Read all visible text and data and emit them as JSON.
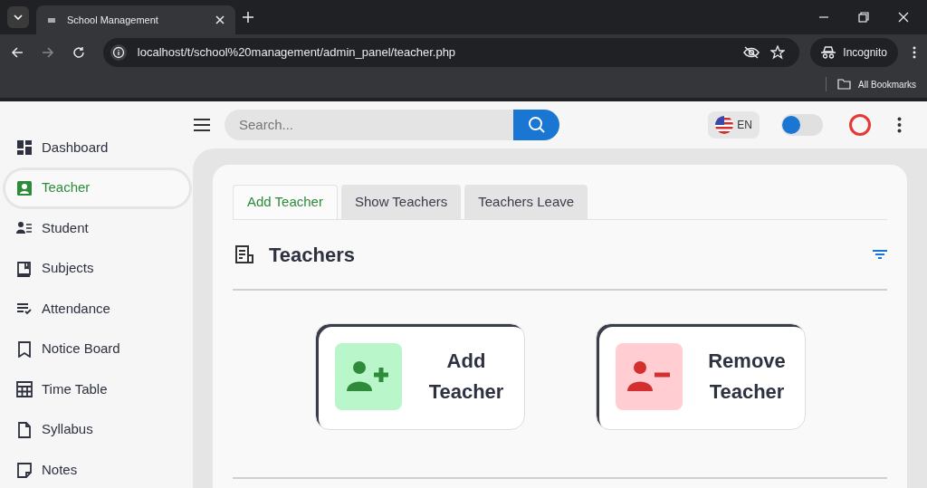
{
  "browser": {
    "tab_title": "School Management",
    "url": "localhost/t/school%20management/admin_panel/teacher.php",
    "profile": "Incognito",
    "bookmarks": "All Bookmarks"
  },
  "header": {
    "search": {
      "placeholder": "Search..."
    },
    "language": "EN",
    "theme_toggle": {
      "on": false
    }
  },
  "sidebar": {
    "items": [
      {
        "label": "Dashboard",
        "selected": false
      },
      {
        "label": "Teacher",
        "selected": true
      },
      {
        "label": "Student",
        "selected": false
      },
      {
        "label": "Subjects",
        "selected": false
      },
      {
        "label": "Attendance",
        "selected": false
      },
      {
        "label": "Notice Board",
        "selected": false
      },
      {
        "label": "Time Table",
        "selected": false
      },
      {
        "label": "Syllabus",
        "selected": false
      },
      {
        "label": "Notes",
        "selected": false
      }
    ]
  },
  "tabs": [
    {
      "label": "Add Teacher",
      "selected": true
    },
    {
      "label": "Show Teachers",
      "selected": false
    },
    {
      "label": "Teachers Leave",
      "selected": false
    }
  ],
  "section": {
    "title": "Teachers"
  },
  "actions": [
    {
      "kind": "add",
      "label": "Add Teacher"
    },
    {
      "kind": "remove",
      "label": "Remove Teacher"
    }
  ]
}
